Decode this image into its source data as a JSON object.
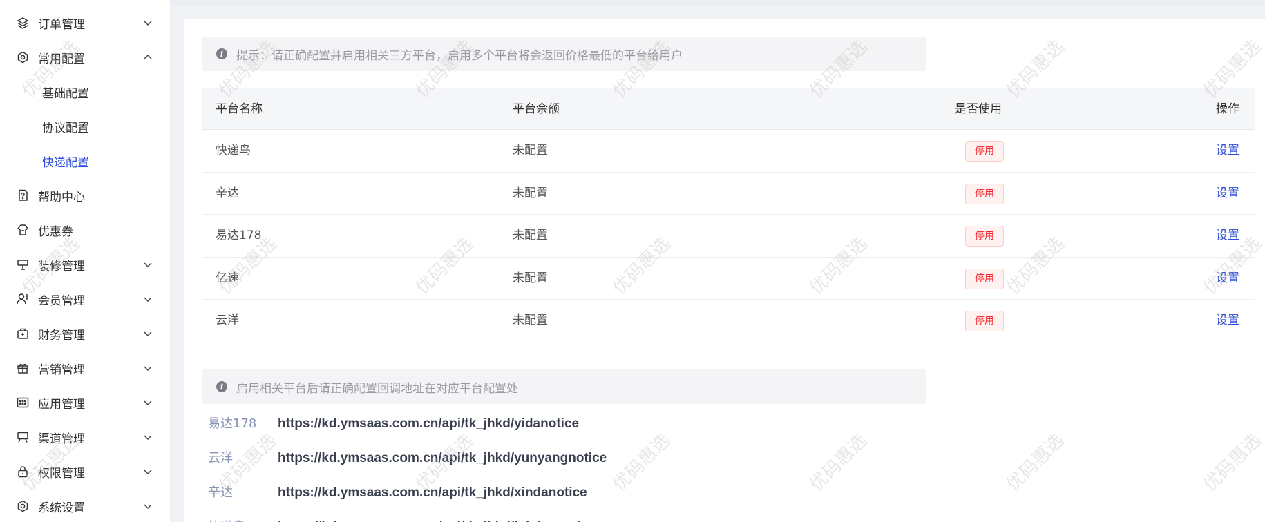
{
  "sidebar": {
    "items": [
      {
        "label": "订单管理",
        "icon": "layers-icon",
        "expandable": true
      },
      {
        "label": "常用配置",
        "icon": "gear-icon",
        "expandable": true,
        "expanded": true
      },
      {
        "label": "帮助中心",
        "icon": "help-doc-icon",
        "expandable": false
      },
      {
        "label": "优惠券",
        "icon": "coupon-icon",
        "expandable": false
      },
      {
        "label": "装修管理",
        "icon": "decorate-icon",
        "expandable": true
      },
      {
        "label": "会员管理",
        "icon": "user-icon",
        "expandable": true
      },
      {
        "label": "财务管理",
        "icon": "finance-icon",
        "expandable": true
      },
      {
        "label": "营销管理",
        "icon": "gift-icon",
        "expandable": true
      },
      {
        "label": "应用管理",
        "icon": "apps-icon",
        "expandable": true
      },
      {
        "label": "渠道管理",
        "icon": "channel-icon",
        "expandable": true
      },
      {
        "label": "权限管理",
        "icon": "lock-icon",
        "expandable": true
      },
      {
        "label": "系统设置",
        "icon": "settings-icon",
        "expandable": true
      }
    ],
    "submenu": [
      {
        "label": "基础配置",
        "active": false
      },
      {
        "label": "协议配置",
        "active": false
      },
      {
        "label": "快递配置",
        "active": true
      }
    ]
  },
  "notice_top": {
    "text": "提示：请正确配置并启用相关三方平台，启用多个平台将会返回价格最低的平台给用户"
  },
  "table": {
    "headers": [
      "平台名称",
      "平台余额",
      "是否使用",
      "操作"
    ],
    "rows": [
      {
        "name": "快递鸟",
        "balance": "未配置",
        "status": "停用",
        "action": "设置"
      },
      {
        "name": "辛达",
        "balance": "未配置",
        "status": "停用",
        "action": "设置"
      },
      {
        "name": "易达178",
        "balance": "未配置",
        "status": "停用",
        "action": "设置"
      },
      {
        "name": "亿速",
        "balance": "未配置",
        "status": "停用",
        "action": "设置"
      },
      {
        "name": "云洋",
        "balance": "未配置",
        "status": "停用",
        "action": "设置"
      }
    ]
  },
  "notice_bottom": {
    "text": "启用相关平台后请正确配置回调地址在对应平台配置处"
  },
  "callbacks": [
    {
      "name": "易达178",
      "url": "https://kd.ymsaas.com.cn/api/tk_jhkd/yidanotice"
    },
    {
      "name": "云洋",
      "url": "https://kd.ymsaas.com.cn/api/tk_jhkd/yunyangnotice"
    },
    {
      "name": "辛达",
      "url": "https://kd.ymsaas.com.cn/api/tk_jhkd/xindanotice"
    },
    {
      "name": "快递鸟",
      "url": "https://kd.ymsaas.com.cn/api/tk_jhkd/kdniaonotice"
    }
  ],
  "watermark": {
    "text": "优码惠选"
  },
  "colors": {
    "accent": "#2d4dd8",
    "danger": "#f5222d",
    "danger_bg": "#fff1f0",
    "notice_bg": "#f4f4f6"
  }
}
